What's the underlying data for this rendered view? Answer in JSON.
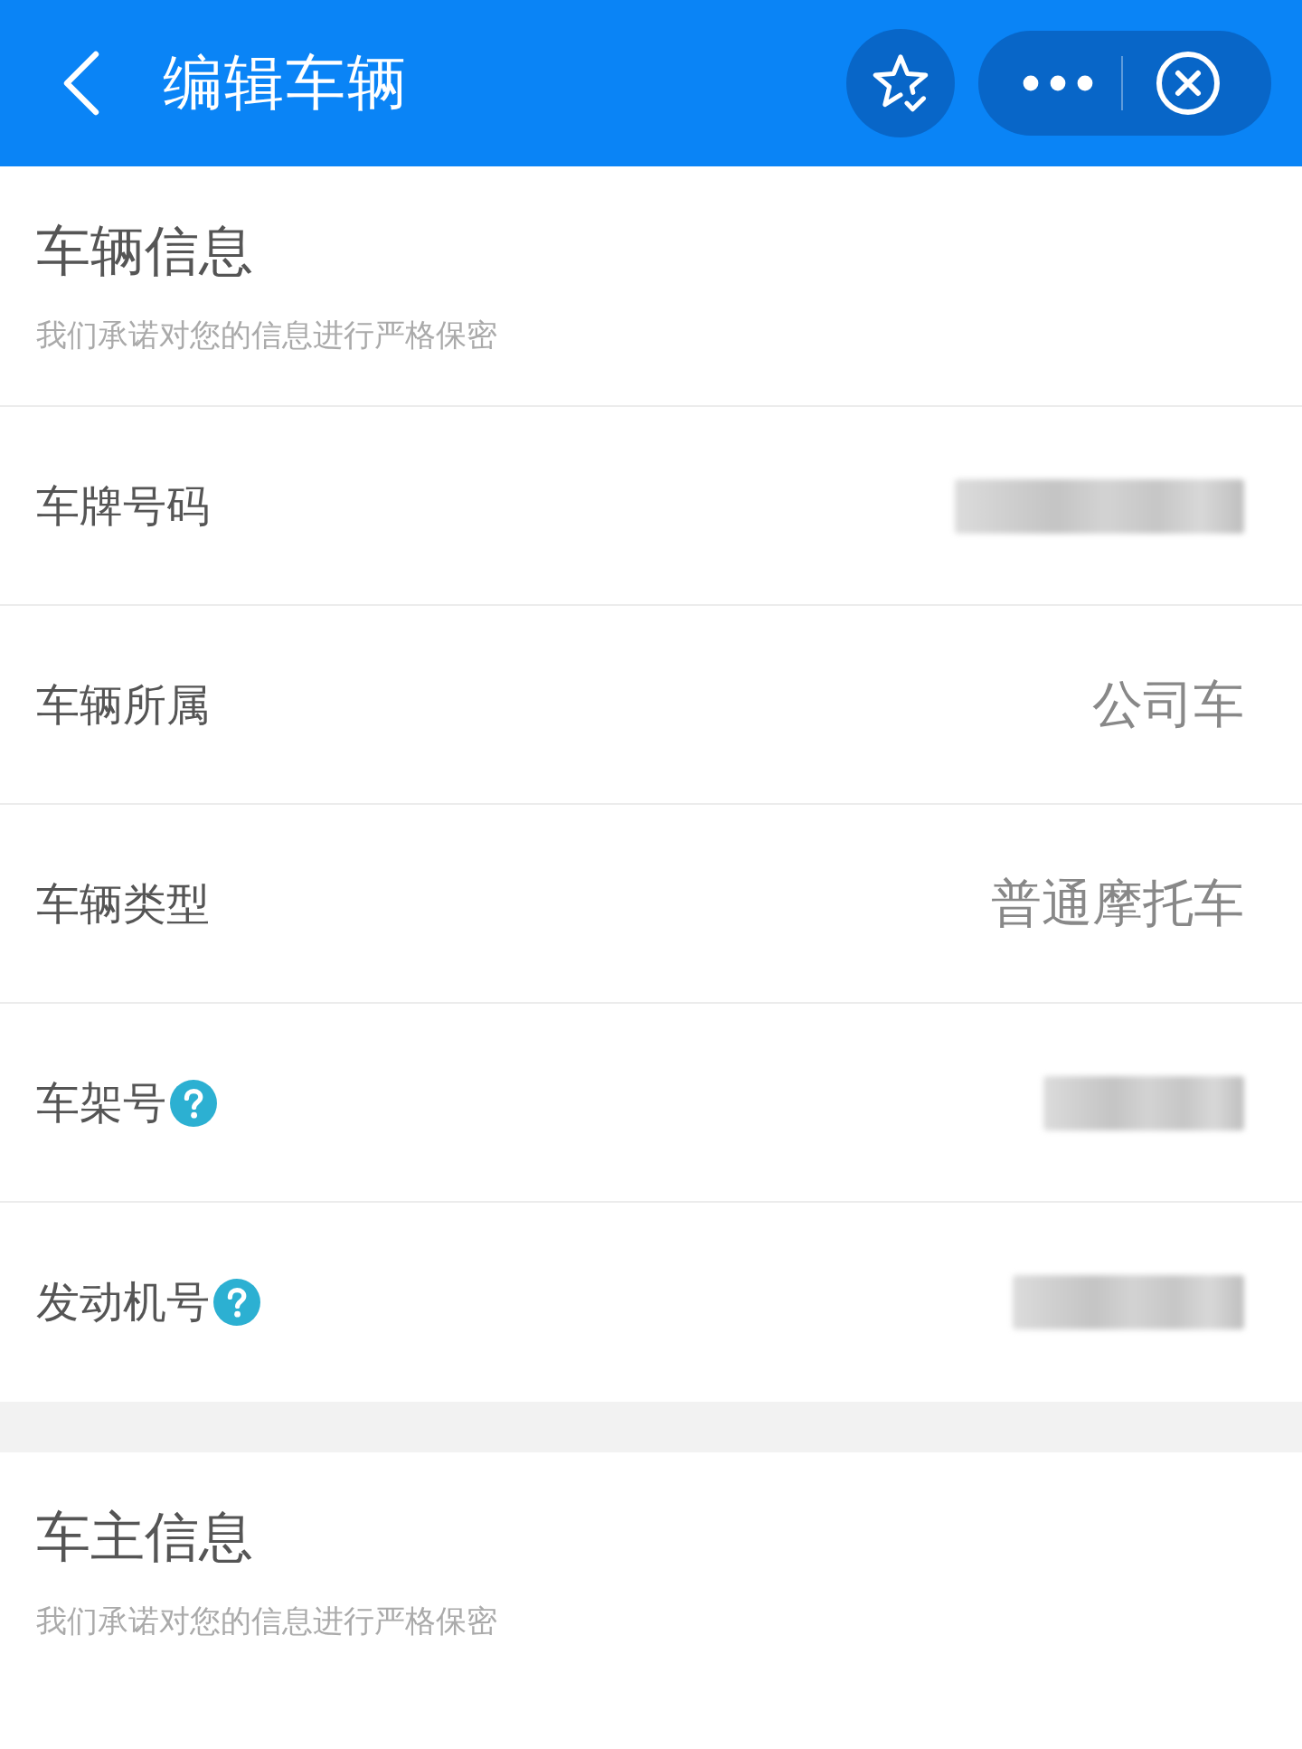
{
  "header": {
    "title": "编辑车辆"
  },
  "sections": [
    {
      "title": "车辆信息",
      "subtitle": "我们承诺对您的信息进行严格保密",
      "rows": [
        {
          "label": "车牌号码",
          "kind": "redacted",
          "help": false
        },
        {
          "label": "车辆所属",
          "kind": "text",
          "value": "公司车",
          "help": false
        },
        {
          "label": "车辆类型",
          "kind": "text",
          "value": "普通摩托车",
          "help": false
        },
        {
          "label": "车架号",
          "kind": "redacted",
          "help": true
        },
        {
          "label": "发动机号",
          "kind": "redacted",
          "help": true
        }
      ]
    },
    {
      "title": "车主信息",
      "subtitle": "我们承诺对您的信息进行严格保密"
    }
  ]
}
